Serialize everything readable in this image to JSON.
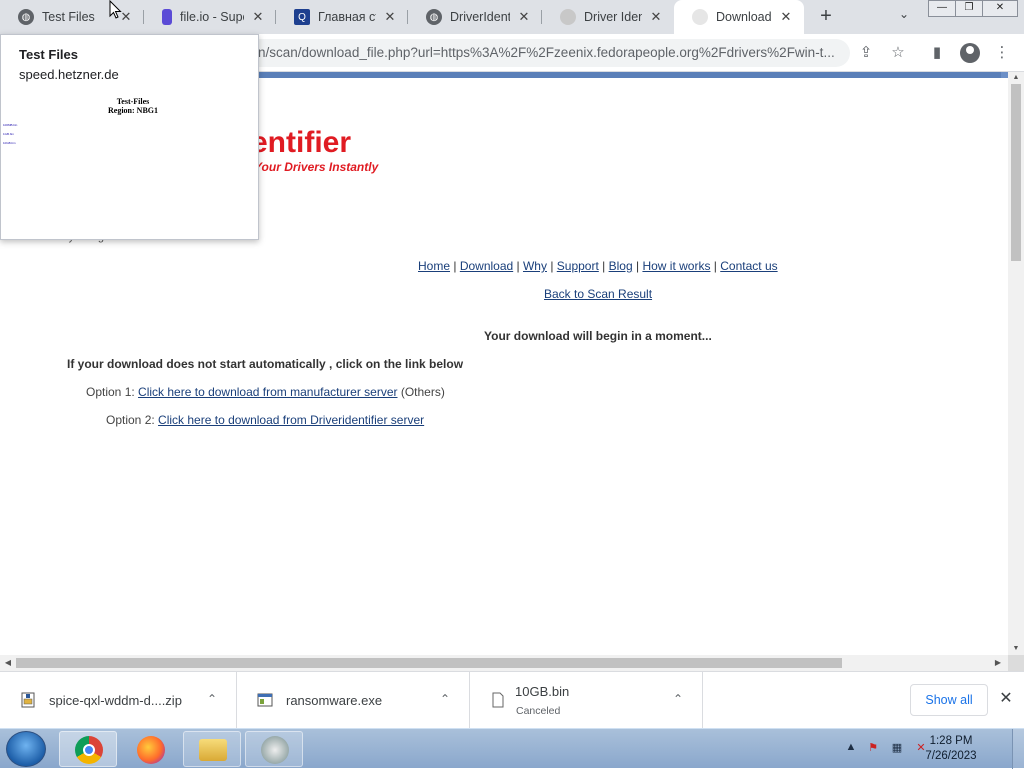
{
  "tabs": [
    {
      "label": "Test Files",
      "close": "✕",
      "icon": "globe"
    },
    {
      "label": "file.io - Supe",
      "close": "✕",
      "icon": "fileio"
    },
    {
      "label": "Главная стра",
      "close": "✕",
      "icon": "qq"
    },
    {
      "label": "DriverIdentifi",
      "close": "✕",
      "icon": "globe"
    },
    {
      "label": "Driver Identi",
      "close": "✕",
      "icon": "driver"
    },
    {
      "label": "Download fil",
      "close": "✕",
      "icon": "driver"
    }
  ],
  "newtab_label": "+",
  "omnibox": {
    "url": "n/scan/download_file.php?url=https%3A%2F%2Fzeenix.fedorapeople.org%2Fdrivers%2Fwin-t..."
  },
  "hovercard": {
    "title": "Test Files",
    "host": "speed.hetzner.de",
    "thumb_title": "Test-Files",
    "thumb_region": "Region: NBG1",
    "thumb_links": [
      "100MB.bin",
      "1GB.bin",
      "10GB.bin"
    ]
  },
  "page": {
    "logo": "entifier",
    "tagline": "Your Drivers Instantly",
    "powered": "Powered by Google Translate",
    "nav": [
      "Home",
      "Download",
      "Why",
      "Support",
      "Blog",
      "How it works",
      "Contact us"
    ],
    "back_link": "Back to Scan Result",
    "begin": "Your download will begin in a moment...",
    "not_start": "If your download does not start automatically , click on the link below",
    "option1_prefix": "Option 1:",
    "option1_link": "Click here to download from manufacturer server",
    "option1_suffix": "(Others)",
    "option2_prefix": "Option 2:",
    "option2_link": "Click here to download from Driveridentifier server"
  },
  "downloads": [
    {
      "name": "spice-qxl-wddm-d....zip",
      "status": ""
    },
    {
      "name": "ransomware.exe",
      "status": ""
    },
    {
      "name": "10GB.bin",
      "status": "Canceled"
    }
  ],
  "show_all": "Show all",
  "clock": {
    "time": "1:28 PM",
    "date": "7/26/2023"
  },
  "colors": {
    "logo_red": "#e01b22",
    "link_blue": "#1a3f7a",
    "accent_blue": "#1a73e8"
  }
}
